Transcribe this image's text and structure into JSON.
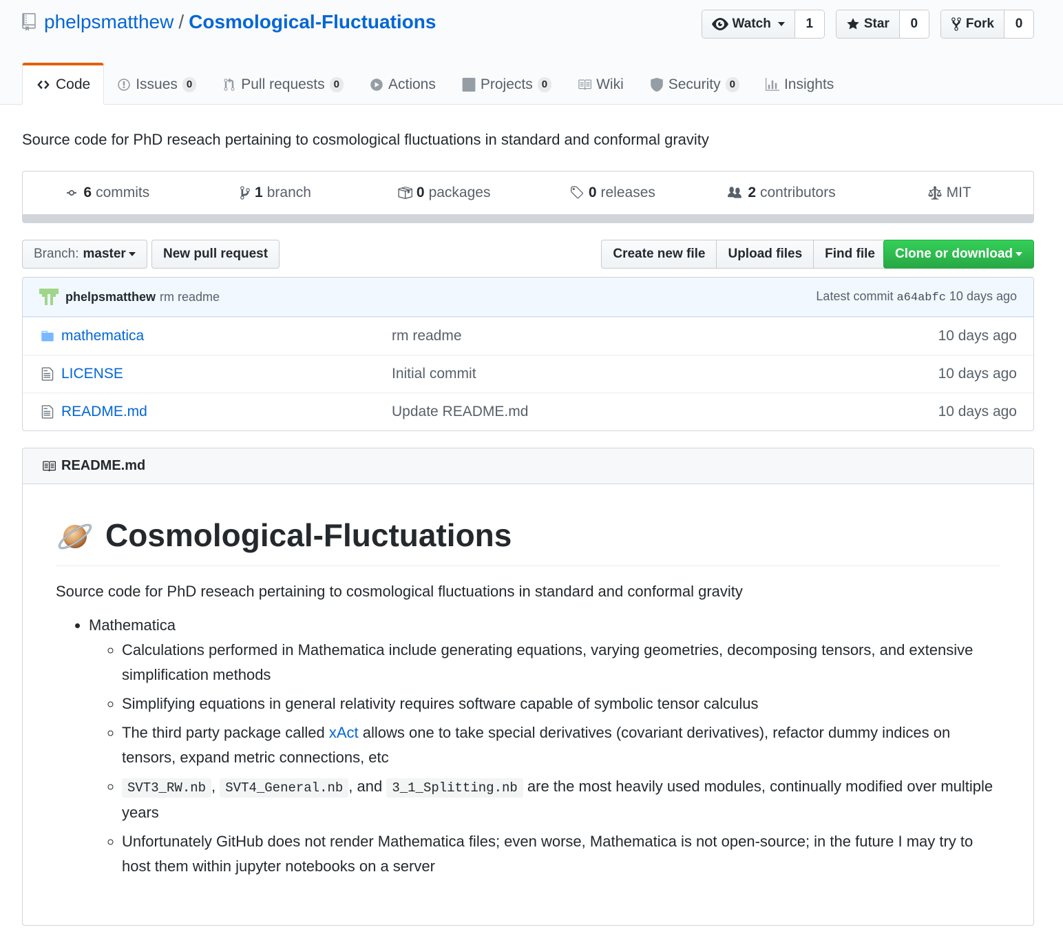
{
  "repo": {
    "owner": "phelpsmatthew",
    "separator": "/",
    "name": "Cosmological-Fluctuations"
  },
  "actions": {
    "watch": {
      "label": "Watch",
      "count": "1"
    },
    "star": {
      "label": "Star",
      "count": "0"
    },
    "fork": {
      "label": "Fork",
      "count": "0"
    }
  },
  "tabs": [
    {
      "label": "Code",
      "icon": "code-icon"
    },
    {
      "label": "Issues",
      "count": "0",
      "icon": "issue-icon"
    },
    {
      "label": "Pull requests",
      "count": "0",
      "icon": "pull-request-icon"
    },
    {
      "label": "Actions",
      "icon": "play-icon"
    },
    {
      "label": "Projects",
      "count": "0",
      "icon": "project-icon"
    },
    {
      "label": "Wiki",
      "icon": "book-icon"
    },
    {
      "label": "Security",
      "count": "0",
      "icon": "shield-icon"
    },
    {
      "label": "Insights",
      "icon": "graph-icon"
    }
  ],
  "description": "Source code for PhD reseach pertaining to cosmological fluctuations in standard and conformal gravity",
  "summary": {
    "commits": {
      "num": "6",
      "label": "commits"
    },
    "branches": {
      "num": "1",
      "label": "branch"
    },
    "packages": {
      "num": "0",
      "label": "packages"
    },
    "releases": {
      "num": "0",
      "label": "releases"
    },
    "contributors": {
      "num": "2",
      "label": "contributors"
    },
    "license": "MIT"
  },
  "filenav": {
    "branch_prefix": "Branch:",
    "branch_name": "master",
    "new_pr": "New pull request",
    "create_file": "Create new file",
    "upload_files": "Upload files",
    "find_file": "Find file",
    "clone": "Clone or download"
  },
  "latest_commit": {
    "author": "phelpsmatthew",
    "message": "rm readme",
    "prefix": "Latest commit",
    "sha": "a64abfc",
    "age": "10 days ago"
  },
  "files": [
    {
      "type": "folder",
      "name": "mathematica",
      "message": "rm readme",
      "age": "10 days ago"
    },
    {
      "type": "file",
      "name": "LICENSE",
      "message": "Initial commit",
      "age": "10 days ago"
    },
    {
      "type": "file",
      "name": "README.md",
      "message": "Update README.md",
      "age": "10 days ago"
    }
  ],
  "readme": {
    "header": "README.md",
    "title": "Cosmological-Fluctuations",
    "intro": "Source code for PhD reseach pertaining to cosmological fluctuations in standard and conformal gravity",
    "top_item": "Mathematica",
    "items": {
      "a": "Calculations performed in Mathematica include generating equations, varying geometries, decomposing tensors, and extensive simplification methods",
      "b": "Simplifying equations in general relativity requires software capable of symbolic tensor calculus",
      "c_pre": "The third party package called ",
      "c_link": "xAct",
      "c_post": " allows one to take special derivatives (covariant derivatives), refactor dummy indices on tensors, expand metric connections, etc",
      "d_code1": "SVT3_RW.nb",
      "d_sep1": ", ",
      "d_code2": "SVT4_General.nb",
      "d_sep2": ", and ",
      "d_code3": "3_1_Splitting.nb",
      "d_post": " are the most heavily used modules, continually modified over multiple years",
      "e": "Unfortunately GitHub does not render Mathematica files; even worse, Mathematica is not open-source; in the future I may try to host them within jupyter notebooks on a server"
    }
  },
  "colors": {
    "accent": "#e36209",
    "link": "#0366d6",
    "green": "#28a745"
  }
}
